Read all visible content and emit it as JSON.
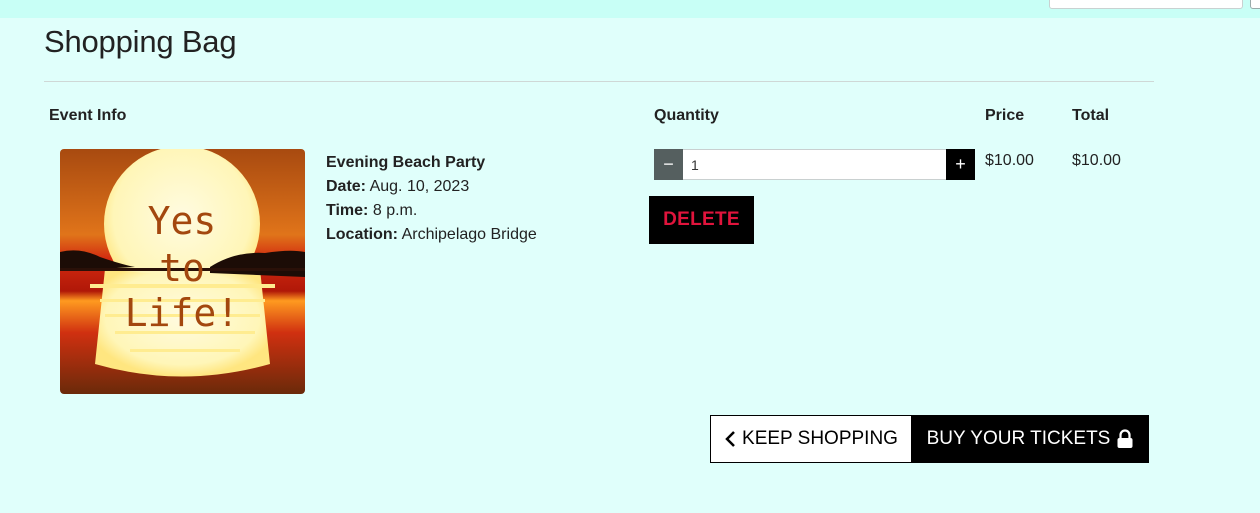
{
  "page": {
    "title": "Shopping Bag"
  },
  "table": {
    "headers": {
      "event_info": "Event Info",
      "quantity": "Quantity",
      "price": "Price",
      "total": "Total"
    }
  },
  "item": {
    "image": {
      "line1": "Yes",
      "line2": "to",
      "line3": "Life!"
    },
    "name": "Evening Beach Party",
    "date_label": "Date:",
    "date_value": "Aug. 10, 2023",
    "time_label": "Time:",
    "time_value": "8 p.m.",
    "location_label": "Location:",
    "location_value": "Archipelago Bridge",
    "quantity": "1",
    "minus_symbol": "−",
    "plus_symbol": "+",
    "delete_label": "DELETE",
    "price": "$10.00",
    "total": "$10.00"
  },
  "actions": {
    "keep_shopping": "KEEP SHOPPING",
    "buy_tickets": "BUY YOUR TICKETS",
    "keep_icon": "chevron-left-icon",
    "buy_icon": "lock-icon"
  },
  "colors": {
    "background": "#e0fffb",
    "delete_text": "#e0143c",
    "button_dark": "#000000"
  }
}
